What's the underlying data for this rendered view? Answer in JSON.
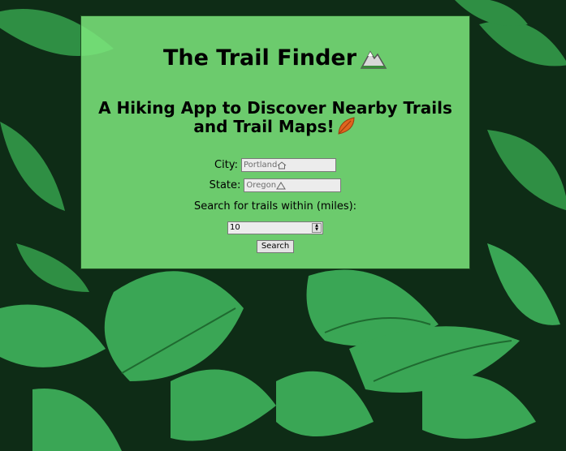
{
  "header": {
    "title": "The Trail Finder",
    "subtitle": "A Hiking App to Discover Nearby Trails and Trail Maps!"
  },
  "icons": {
    "title_icon": "mountain-icon",
    "subtitle_icon": "fallen-leaf-icon",
    "city_icon": "house-icon",
    "state_icon": "mountain-icon"
  },
  "form": {
    "city_label": "City:",
    "city_placeholder": "Portland",
    "state_label": "State:",
    "state_placeholder": "Oregon",
    "miles_label": "Search for trails within (miles):",
    "miles_value": "10",
    "search_button": "Search"
  },
  "colors": {
    "panel_bg": "#7ce87c",
    "leaf_green": "#3fae5a"
  }
}
